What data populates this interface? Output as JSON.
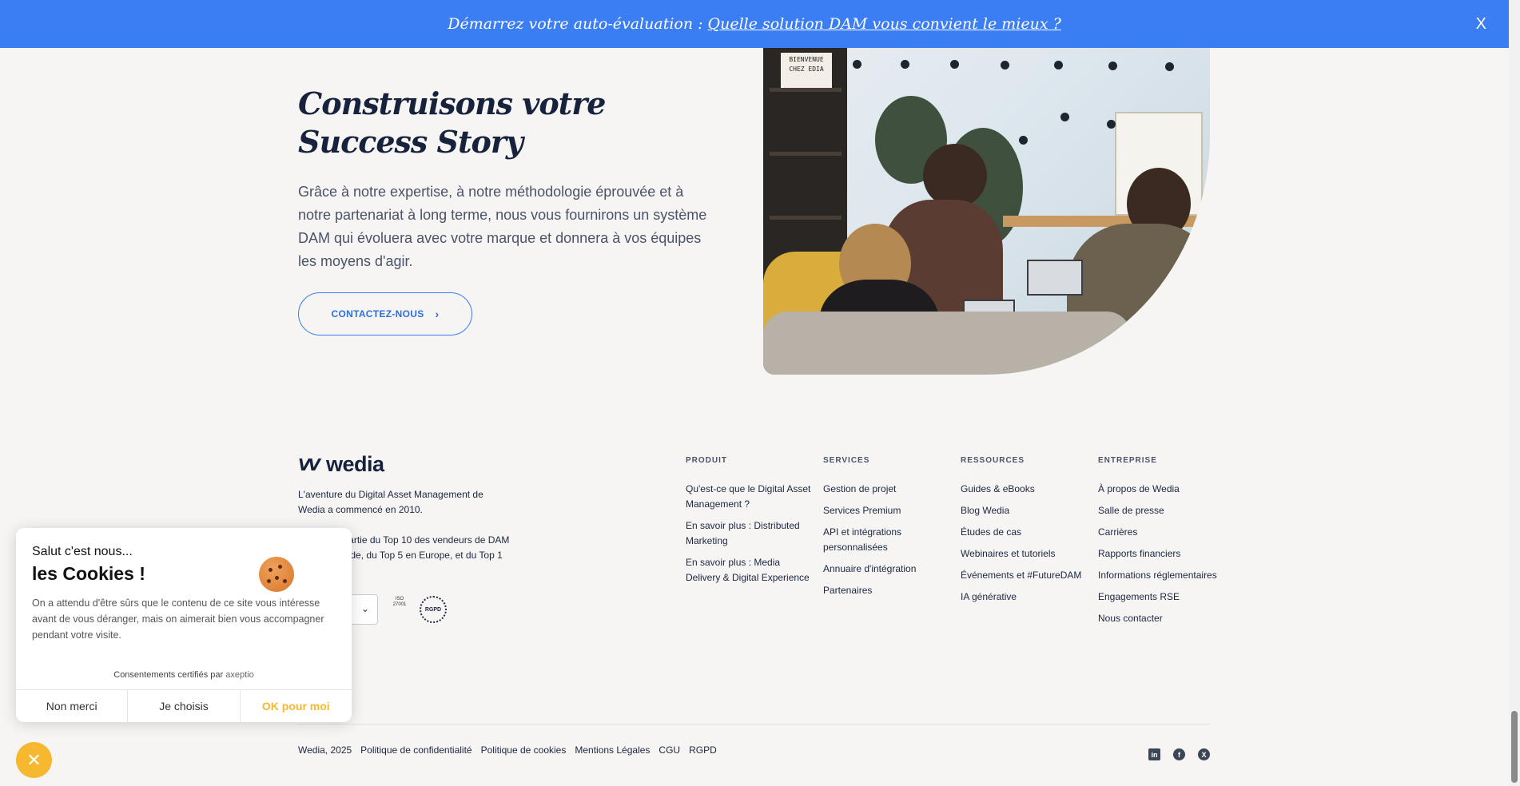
{
  "banner": {
    "text": "Démarrez votre auto-évaluation :",
    "link": "Quelle solution DAM vous convient le mieux ?",
    "close": "X"
  },
  "hero": {
    "title_line1": "Construisons votre",
    "title_line2": "Success Story",
    "text": "Grâce à notre expertise, à notre méthodologie éprouvée et à notre partenariat à long terme, nous vous fournirons un système DAM qui évoluera avec votre marque et donnera à vos équipes les moyens d'agir.",
    "cta": "CONTACTEZ-NOUS",
    "photo_sign": "BIENVENUE CHEZ EDIA"
  },
  "footer": {
    "logo": "wedia",
    "about1": "L'aventure du Digital Asset Management de Wedia a commencé en 2010.",
    "about2": "Wedia fait partie du Top 10 des vendeurs de DAM dans le monde, du Top 5 en Europe, et du Top 1 en France.",
    "badge_iso": "ISO 27001",
    "badge_rgpd": "RGPD",
    "columns": [
      {
        "title": "PRODUIT",
        "items": [
          "Qu'est-ce que le Digital Asset Management ?",
          "En savoir plus : Distributed Marketing",
          "En savoir plus : Media Delivery & Digital Experience"
        ]
      },
      {
        "title": "SERVICES",
        "items": [
          "Gestion de projet",
          "Services Premium",
          "API et intégrations personnalisées",
          "Annuaire d'intégration",
          "Partenaires"
        ]
      },
      {
        "title": "RESSOURCES",
        "items": [
          "Guides & eBooks",
          "Blog Wedia",
          "Études de cas",
          "Webinaires et tutoriels",
          "Événements et #FutureDAM",
          "IA générative"
        ]
      },
      {
        "title": "ENTREPRISE",
        "items": [
          "À propos de Wedia",
          "Salle de presse",
          "Carrières",
          "Rapports financiers",
          "Informations réglementaires",
          "Engagements RSE",
          "Nous contacter"
        ]
      }
    ],
    "bottom": {
      "copyright": "Wedia, 2025",
      "links": [
        "Politique de confidentialité",
        "Politique de cookies",
        "Mentions Légales",
        "CGU",
        "RGPD"
      ]
    },
    "socials": [
      "linkedin-icon",
      "facebook-icon",
      "x-icon"
    ]
  },
  "cookie": {
    "hello": "Salut c'est nous...",
    "title": "les Cookies !",
    "message": "On a attendu d'être sûrs que le contenu de ce site vous intéresse avant de vous déranger, mais on aimerait bien vous accompagner pendant votre visite.",
    "certified": "Consentements certifiés par",
    "brand": "axeptio",
    "btn_no": "Non merci",
    "btn_choose": "Je choisis",
    "btn_ok": "OK pour moi"
  },
  "colors": {
    "accent": "#3b7df2",
    "cookie_accent": "#f5b82e",
    "text": "#1b2740"
  }
}
